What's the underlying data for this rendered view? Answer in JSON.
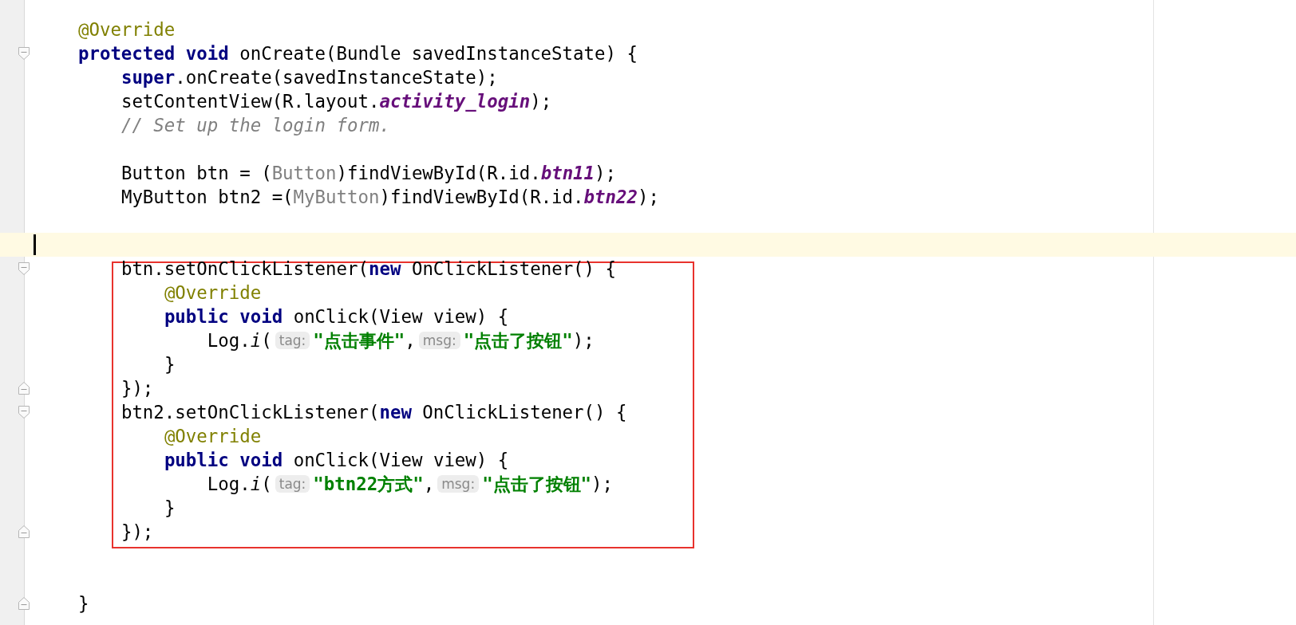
{
  "editor": {
    "lines": [
      {
        "boxed": false,
        "current": false,
        "tokens": [
          {
            "kind": "annotation",
            "text": "@Override"
          }
        ]
      },
      {
        "boxed": false,
        "current": false,
        "fold_marker": {
          "kind": "start"
        },
        "tokens": [
          {
            "kind": "keyword",
            "text": "protected void"
          },
          {
            "kind": "plain",
            "text": " onCreate(Bundle savedInstanceState) {"
          }
        ],
        "children": [
          {
            "boxed": false,
            "current": false,
            "tokens": [
              {
                "kind": "keyword",
                "text": "super"
              },
              {
                "kind": "plain",
                "text": ".onCreate(savedInstanceState);"
              }
            ]
          },
          {
            "boxed": false,
            "current": false,
            "tokens": [
              {
                "kind": "plain",
                "text": "setContentView(R.layout."
              },
              {
                "kind": "field",
                "text": "activity_login"
              },
              {
                "kind": "plain",
                "text": ");"
              }
            ]
          },
          {
            "boxed": false,
            "current": false,
            "tokens": [
              {
                "kind": "comment",
                "text": "// Set up the login form."
              }
            ]
          },
          {
            "boxed": false,
            "current": false
          },
          {
            "boxed": false,
            "current": false,
            "tokens": [
              {
                "kind": "plain",
                "text": "Button btn = ("
              },
              {
                "kind": "cast",
                "text": "Button"
              },
              {
                "kind": "plain",
                "text": ")findViewById(R.id."
              },
              {
                "kind": "field",
                "text": "btn11"
              },
              {
                "kind": "plain",
                "text": ");"
              }
            ]
          },
          {
            "boxed": false,
            "current": false,
            "tokens": [
              {
                "kind": "plain",
                "text": "MyButton btn2 =("
              },
              {
                "kind": "cast",
                "text": "MyButton"
              },
              {
                "kind": "plain",
                "text": ")findViewById(R.id."
              },
              {
                "kind": "field",
                "text": "btn22"
              },
              {
                "kind": "plain",
                "text": ");"
              }
            ]
          },
          {
            "boxed": false,
            "current": false
          },
          {
            "boxed": false,
            "current": true
          },
          {
            "boxed": true,
            "current": false,
            "fold_marker": {
              "kind": "start"
            },
            "tokens": [
              {
                "kind": "plain",
                "text": "btn.setOnClickListener("
              },
              {
                "kind": "keyword",
                "text": "new"
              },
              {
                "kind": "plain",
                "text": " OnClickListener() {"
              }
            ],
            "children": [
              {
                "boxed": true,
                "current": false,
                "tokens": [
                  {
                    "kind": "annotation",
                    "text": "@Override"
                  }
                ]
              },
              {
                "boxed": true,
                "current": false,
                "tokens": [
                  {
                    "kind": "keyword",
                    "text": "public void"
                  },
                  {
                    "kind": "plain",
                    "text": " onClick(View view) {"
                  }
                ],
                "children": [
                  {
                    "boxed": true,
                    "current": false,
                    "tokens": [
                      {
                        "kind": "plain",
                        "text": "Log."
                      },
                      {
                        "kind": "method",
                        "text": "i"
                      },
                      {
                        "kind": "plain",
                        "text": "("
                      },
                      {
                        "kind": "hint",
                        "text": "tag:"
                      },
                      {
                        "kind": "string",
                        "text": "\"点击事件\""
                      },
                      {
                        "kind": "plain",
                        "text": ","
                      },
                      {
                        "kind": "hint",
                        "text": "msg:"
                      },
                      {
                        "kind": "string",
                        "text": "\"点击了按钮\""
                      },
                      {
                        "kind": "plain",
                        "text": ");"
                      }
                    ]
                  }
                ]
              },
              {
                "boxed": true,
                "current": false,
                "tokens": [
                  {
                    "kind": "plain",
                    "text": "}"
                  }
                ]
              }
            ]
          },
          {
            "boxed": true,
            "current": false,
            "fold_marker": {
              "kind": "end"
            },
            "tokens": [
              {
                "kind": "plain",
                "text": "});"
              }
            ]
          },
          {
            "boxed": true,
            "current": false,
            "fold_marker": {
              "kind": "start"
            },
            "tokens": [
              {
                "kind": "plain",
                "text": "btn2.setOnClickListener("
              },
              {
                "kind": "keyword",
                "text": "new"
              },
              {
                "kind": "plain",
                "text": " OnClickListener() {"
              }
            ],
            "children": [
              {
                "boxed": true,
                "current": false,
                "tokens": [
                  {
                    "kind": "annotation",
                    "text": "@Override"
                  }
                ]
              },
              {
                "boxed": true,
                "current": false,
                "tokens": [
                  {
                    "kind": "keyword",
                    "text": "public void"
                  },
                  {
                    "kind": "plain",
                    "text": " onClick(View view) {"
                  }
                ],
                "children": [
                  {
                    "boxed": true,
                    "current": false,
                    "tokens": [
                      {
                        "kind": "plain",
                        "text": "Log."
                      },
                      {
                        "kind": "method",
                        "text": "i"
                      },
                      {
                        "kind": "plain",
                        "text": "("
                      },
                      {
                        "kind": "hint",
                        "text": "tag:"
                      },
                      {
                        "kind": "string",
                        "text": "\"btn22方式\""
                      },
                      {
                        "kind": "plain",
                        "text": ","
                      },
                      {
                        "kind": "hint",
                        "text": "msg:"
                      },
                      {
                        "kind": "string",
                        "text": "\"点击了按钮\""
                      },
                      {
                        "kind": "plain",
                        "text": ");"
                      }
                    ]
                  }
                ]
              },
              {
                "boxed": true,
                "current": false,
                "tokens": [
                  {
                    "kind": "plain",
                    "text": "}"
                  }
                ]
              }
            ]
          },
          {
            "boxed": true,
            "current": false,
            "fold_marker": {
              "kind": "end"
            },
            "tokens": [
              {
                "kind": "plain",
                "text": "});"
              }
            ]
          },
          {
            "boxed": false,
            "current": false
          },
          {
            "boxed": false,
            "current": false
          }
        ]
      },
      {
        "boxed": false,
        "current": false,
        "fold_marker": {
          "kind": "end"
        },
        "tokens": [
          {
            "kind": "plain",
            "text": "}"
          }
        ]
      }
    ]
  }
}
